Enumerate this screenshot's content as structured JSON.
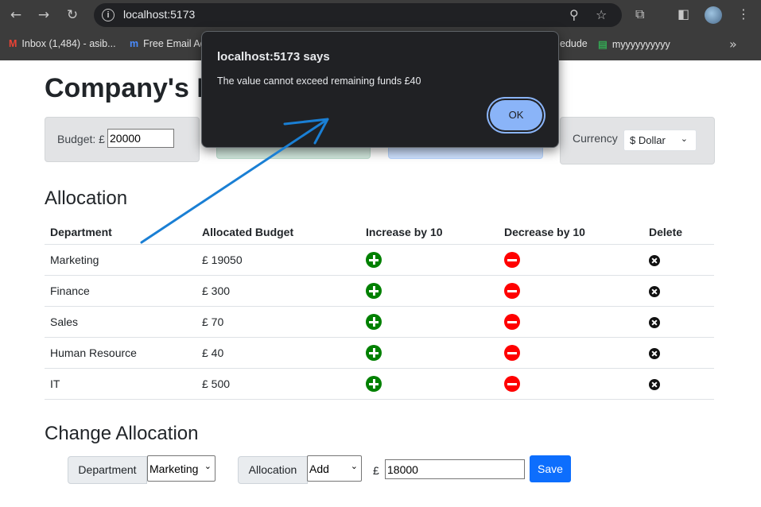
{
  "browser": {
    "url": "localhost:5173",
    "bookmarks": [
      {
        "label": "Inbox (1,484) - asib...",
        "icon": "gmail-icon"
      },
      {
        "label": "Free Email Ad",
        "icon": "m-icon"
      },
      {
        "label": "edude",
        "icon": ""
      },
      {
        "label": "myyyyyyyyyy",
        "icon": "sheets-icon"
      }
    ]
  },
  "page": {
    "title": "Company's B",
    "budget": {
      "label": "Budget: £",
      "value": "20000"
    },
    "currency": {
      "label": "Currency",
      "selected": "$ Dollar"
    }
  },
  "allocation": {
    "heading": "Allocation",
    "columns": [
      "Department",
      "Allocated Budget",
      "Increase by 10",
      "Decrease by 10",
      "Delete"
    ],
    "rows": [
      {
        "department": "Marketing",
        "budget": "£ 19050"
      },
      {
        "department": "Finance",
        "budget": "£ 300"
      },
      {
        "department": "Sales",
        "budget": "£ 70"
      },
      {
        "department": "Human Resource",
        "budget": "£ 40"
      },
      {
        "department": "IT",
        "budget": "£ 500"
      }
    ]
  },
  "change_allocation": {
    "heading": "Change Allocation",
    "department_label": "Department",
    "department_selected": "Marketing",
    "allocation_label": "Allocation",
    "action_selected": "Add",
    "currency_symbol": "£",
    "amount": "18000",
    "save_label": "Save"
  },
  "dialog": {
    "title": "localhost:5173 says",
    "message": "The value cannot exceed remaining funds  £40",
    "ok_label": "OK"
  },
  "colors": {
    "increase": "#008000",
    "decrease": "#ff0000",
    "save": "#0d6efd",
    "annotation_arrow": "#1a7fd4"
  }
}
